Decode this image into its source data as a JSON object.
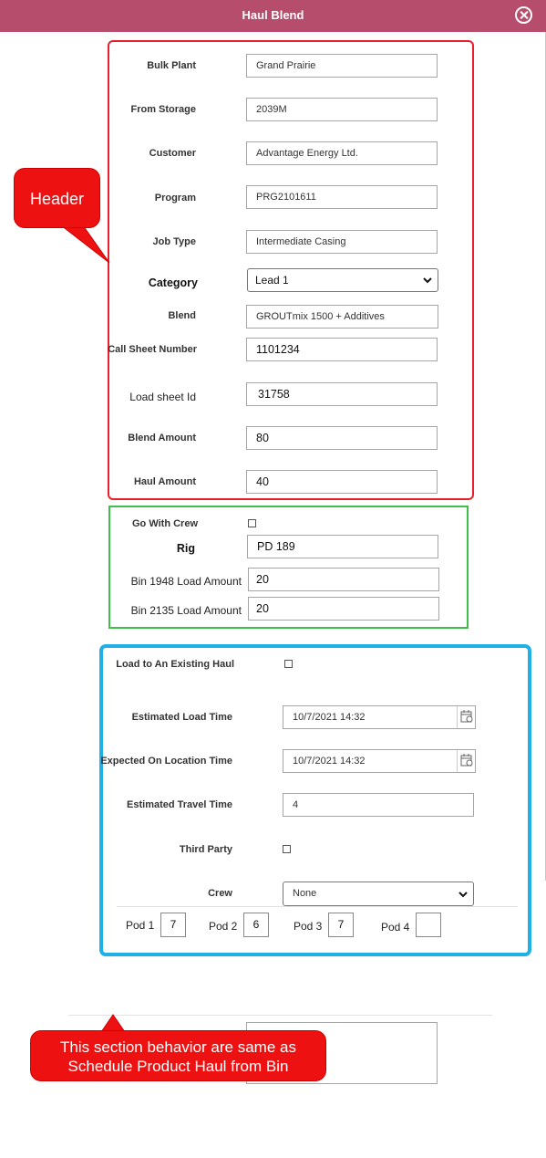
{
  "dialog": {
    "title": "Haul Blend"
  },
  "header_fields": {
    "bulk_plant": {
      "label": "Bulk Plant",
      "value": "Grand Prairie"
    },
    "from_storage": {
      "label": "From Storage",
      "value": "2039M"
    },
    "customer": {
      "label": "Customer",
      "value": "Advantage Energy Ltd."
    },
    "program": {
      "label": "Program",
      "value": "PRG2101611"
    },
    "job_type": {
      "label": "Job Type",
      "value": "Intermediate Casing"
    },
    "category": {
      "label": "Category",
      "value": "Lead 1"
    },
    "blend": {
      "label": "Blend",
      "value": "GROUTmix 1500 + Additives"
    },
    "call_sheet_number": {
      "label": "Call Sheet Number",
      "value": "1101234"
    },
    "load_sheet_id": {
      "label": "Load sheet Id",
      "value": "31758"
    },
    "blend_amount": {
      "label": "Blend Amount",
      "value": "80"
    },
    "haul_amount": {
      "label": "Haul Amount",
      "value": "40"
    }
  },
  "crew_section": {
    "go_with_crew": {
      "label": "Go With Crew",
      "checked": false
    },
    "rig": {
      "label": "Rig",
      "value": "PD 189"
    },
    "bin_1948": {
      "label": "Bin 1948 Load Amount",
      "value": "20"
    },
    "bin_2135": {
      "label": "Bin 2135 Load Amount",
      "value": "20"
    }
  },
  "haul_section": {
    "load_existing": {
      "label": "Load to An Existing Haul",
      "checked": false
    },
    "estimated_load_time": {
      "label": "Estimated Load Time",
      "value": "10/7/2021 14:32"
    },
    "expected_on_location_time": {
      "label": "Expected On Location Time",
      "value": "10/7/2021 14:32"
    },
    "estimated_travel_time": {
      "label": "Estimated Travel Time",
      "value": "4"
    },
    "third_party": {
      "label": "Third Party",
      "checked": false
    },
    "crew": {
      "label": "Crew",
      "value": "None"
    },
    "pods": [
      {
        "label": "Pod 1",
        "value": "7"
      },
      {
        "label": "Pod 2",
        "value": "6"
      },
      {
        "label": "Pod  3",
        "value": "7"
      },
      {
        "label": "Pod  4",
        "value": ""
      }
    ]
  },
  "annotations": {
    "header_callout": "Header",
    "bottom_callout_line1": "This section behavior are same as",
    "bottom_callout_line2": "Schedule Product Haul from Bin"
  },
  "colors": {
    "titlebar": "#b64d6c",
    "header_box": "#e8202a",
    "crew_box": "#3fbf4a",
    "haul_box": "#1fb0e6",
    "callout": "#ee1111"
  },
  "icons": [
    "close-icon",
    "chevron-down-icon",
    "calendar-icon"
  ]
}
